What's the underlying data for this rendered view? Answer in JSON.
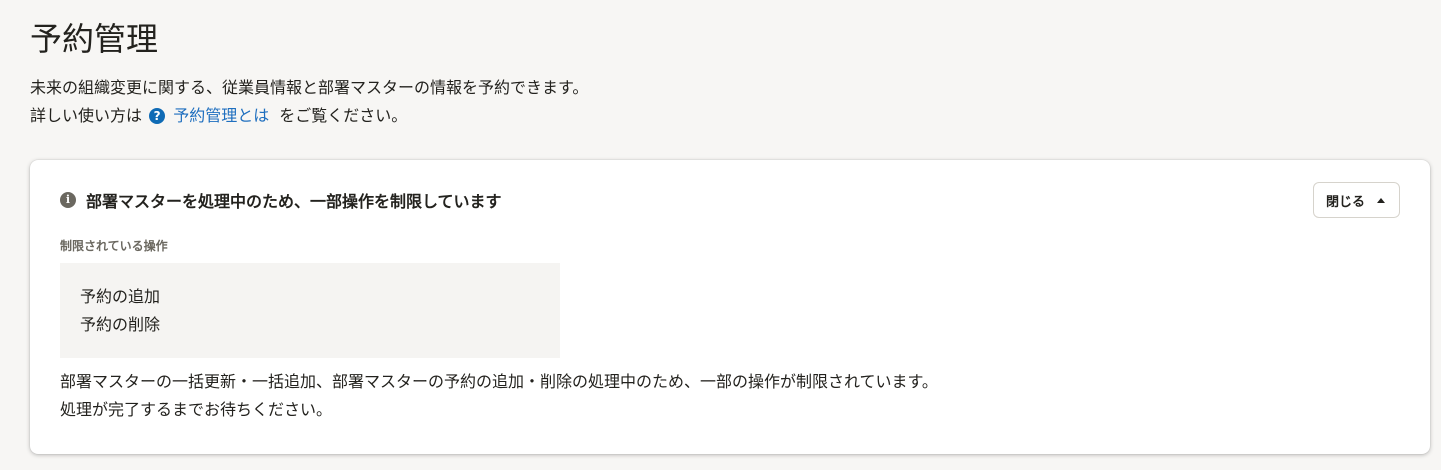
{
  "page": {
    "title": "予約管理",
    "description_line1": "未来の組織変更に関する、従業員情報と部署マスターの情報を予約できます。",
    "description_line2_prefix": "詳しい使い方は",
    "help_icon": "?",
    "help_link_label": "予約管理とは",
    "description_line2_suffix": "をご覧ください。"
  },
  "notice": {
    "icon": "info-icon",
    "info_glyph": "i",
    "title": "部署マスターを処理中のため、一部操作を制限しています",
    "close_button_label": "閉じる",
    "restricted_label": "制限されている操作",
    "restricted_items": [
      "予約の追加",
      "予約の削除"
    ],
    "message_line1": "部署マスターの一括更新・一括追加、部署マスターの予約の追加・削除の処理中のため、一部の操作が制限されています。",
    "message_line2": "処理が完了するまでお待ちください。"
  },
  "colors": {
    "background": "#f7f6f4",
    "link": "#1f6fbf",
    "help_icon": "#0f6bb5",
    "info_icon": "#6b6860"
  }
}
